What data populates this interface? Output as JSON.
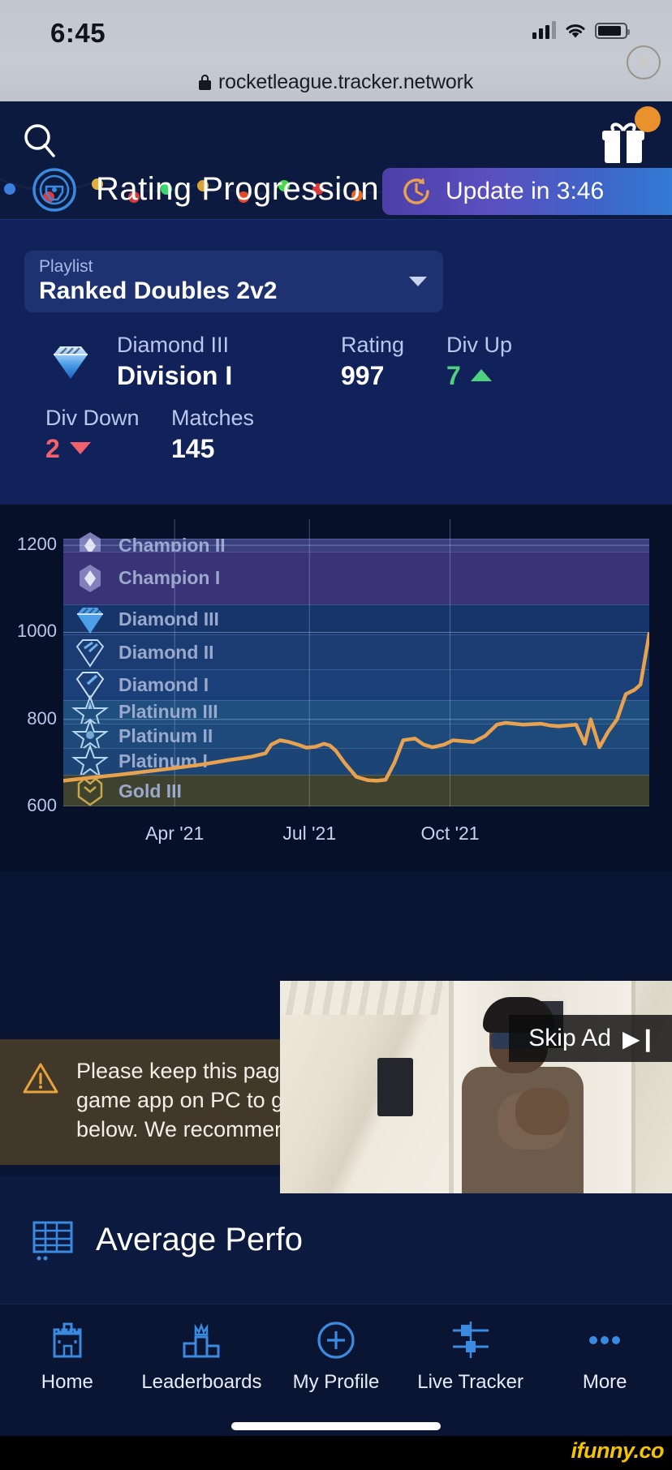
{
  "status_bar": {
    "time": "6:45",
    "signal_icon": "cellular-bars-icon",
    "wifi_icon": "wifi-icon",
    "battery_icon": "battery-icon"
  },
  "browser": {
    "lock_icon": "lock-icon",
    "url": "rocketleague.tracker.network"
  },
  "header": {
    "search_icon": "search-icon",
    "gift_icon": "gift-icon",
    "gift_badge_color": "#e8912d",
    "logo_icon": "rocket-league-logo-icon",
    "title": "Rating Progression",
    "update_icon": "refresh-timer-icon",
    "update_label": "Update in 3:46"
  },
  "playlist": {
    "label": "Playlist",
    "value": "Ranked Doubles 2v2",
    "caret_icon": "chevron-down-icon"
  },
  "stats": {
    "rank_icon": "diamond-rank-icon",
    "rank_tier": "Diamond III",
    "rank_division": "Division I",
    "rating_label": "Rating",
    "rating_value": "997",
    "div_up_label": "Div Up",
    "div_up_value": "7",
    "div_up_icon": "triangle-up-icon",
    "div_up_color": "#4fd17f",
    "div_down_label": "Div Down",
    "div_down_value": "2",
    "div_down_icon": "triangle-down-icon",
    "div_down_color": "#f3616c",
    "matches_label": "Matches",
    "matches_value": "145"
  },
  "chart_data": {
    "type": "line",
    "title": "Rating Progression",
    "xlabel": "",
    "ylabel": "Rating",
    "ylim": [
      600,
      1260
    ],
    "yticks": [
      600,
      800,
      1000,
      1200
    ],
    "x_tick_labels": [
      "Apr '21",
      "Jul '21",
      "Oct '21"
    ],
    "x_tick_positions": [
      0.19,
      0.42,
      0.66
    ],
    "grid": true,
    "legend": "none",
    "line_color": "#e8a24f",
    "series": [
      {
        "name": "Rating",
        "x": [
          0.0,
          0.04,
          0.09,
          0.14,
          0.19,
          0.24,
          0.28,
          0.32,
          0.345,
          0.355,
          0.37,
          0.385,
          0.4,
          0.415,
          0.43,
          0.445,
          0.455,
          0.465,
          0.48,
          0.5,
          0.52,
          0.535,
          0.55,
          0.565,
          0.58,
          0.6,
          0.615,
          0.63,
          0.65,
          0.665,
          0.68,
          0.7,
          0.72,
          0.74,
          0.755,
          0.77,
          0.785,
          0.8,
          0.815,
          0.83,
          0.845,
          0.86,
          0.875,
          0.89,
          0.9,
          0.915,
          0.93,
          0.945,
          0.96,
          0.975,
          0.985,
          1.0
        ],
        "y": [
          659,
          665,
          672,
          680,
          688,
          697,
          706,
          714,
          722,
          742,
          752,
          748,
          742,
          735,
          737,
          744,
          740,
          728,
          700,
          668,
          660,
          659,
          661,
          700,
          752,
          756,
          742,
          736,
          742,
          752,
          750,
          748,
          762,
          788,
          792,
          790,
          788,
          789,
          790,
          786,
          784,
          786,
          788,
          744,
          800,
          736,
          772,
          800,
          858,
          868,
          880,
          997
        ]
      }
    ],
    "rank_bands": [
      {
        "name": "Champion II",
        "top": 1215,
        "bottom": 1185,
        "icon": "champion-rank-icon",
        "color": "#3b3f80"
      },
      {
        "name": "Champion I",
        "top": 1185,
        "bottom": 1065,
        "icon": "champion-rank-icon",
        "color": "#3a3378"
      },
      {
        "name": "Diamond III",
        "top": 1065,
        "bottom": 995,
        "icon": "diamond3-rank-icon",
        "color": "#15356b"
      },
      {
        "name": "Diamond II",
        "top": 995,
        "bottom": 915,
        "icon": "diamond2-rank-icon",
        "color": "#1a3c73"
      },
      {
        "name": "Diamond I",
        "top": 915,
        "bottom": 845,
        "icon": "diamond1-rank-icon",
        "color": "#1b4079"
      },
      {
        "name": "Platinum III",
        "top": 845,
        "bottom": 790,
        "icon": "platinum3-rank-icon",
        "color": "#1e4f7e"
      },
      {
        "name": "Platinum II",
        "top": 790,
        "bottom": 735,
        "icon": "platinum2-rank-icon",
        "color": "#1d4a7a"
      },
      {
        "name": "Platinum I",
        "top": 735,
        "bottom": 672,
        "icon": "platinum1-rank-icon",
        "color": "#1c4475"
      },
      {
        "name": "Gold III",
        "top": 672,
        "bottom": 600,
        "icon": "gold3-rank-icon",
        "color": "#3e422f"
      }
    ]
  },
  "warning": {
    "icon": "warning-triangle-icon",
    "text": "Please keep this page open while playing or use our in-game app on PC to get accurate data in the sections below. We recommend us                      new season for the most",
    "close_icon": "close-circle-icon"
  },
  "ad": {
    "skip_label": "Skip Ad",
    "skip_icon": "skip-next-icon"
  },
  "avg_section": {
    "icon": "table-chart-icon",
    "title": "Average Perfo"
  },
  "bottom_nav": {
    "items": [
      {
        "label": "Home",
        "icon": "castle-home-icon"
      },
      {
        "label": "Leaderboards",
        "icon": "podium-icon"
      },
      {
        "label": "My Profile",
        "icon": "plus-circle-icon"
      },
      {
        "label": "Live Tracker",
        "icon": "live-tracker-icon"
      },
      {
        "label": "More",
        "icon": "ellipsis-icon"
      }
    ]
  },
  "watermark": {
    "text": "ifunny.co"
  }
}
